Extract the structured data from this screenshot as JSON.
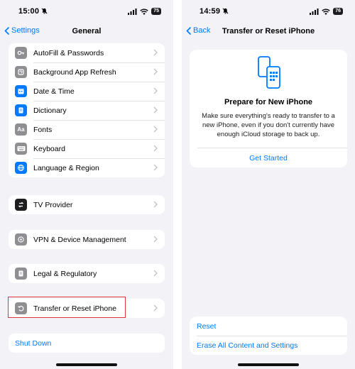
{
  "left_screen": {
    "status": {
      "time": "15:00",
      "battery": "75"
    },
    "nav": {
      "back_label": "Settings",
      "title": "General"
    },
    "group1": [
      {
        "label": "AutoFill & Passwords",
        "icon": "key-icon",
        "color": "#8e8e93"
      },
      {
        "label": "Background App Refresh",
        "icon": "refresh-icon",
        "color": "#8e8e93"
      },
      {
        "label": "Date & Time",
        "icon": "calendar-clock-icon",
        "color": "#007aff"
      },
      {
        "label": "Dictionary",
        "icon": "book-icon",
        "color": "#007aff"
      },
      {
        "label": "Fonts",
        "icon": "fonts-icon",
        "glyph": "Aa",
        "color": "#8e8e93"
      },
      {
        "label": "Keyboard",
        "icon": "keyboard-icon",
        "color": "#8e8e93"
      },
      {
        "label": "Language & Region",
        "icon": "globe-icon",
        "color": "#007aff"
      }
    ],
    "tv_provider": {
      "label": "TV Provider",
      "icon": "tv-provider-icon",
      "color": "#1c1c1e"
    },
    "vpn": {
      "label": "VPN & Device Management",
      "icon": "gear-icon",
      "color": "#8e8e93"
    },
    "legal": {
      "label": "Legal & Regulatory",
      "icon": "document-icon",
      "color": "#8e8e93"
    },
    "transfer": {
      "label": "Transfer or Reset iPhone",
      "icon": "reset-arrow-icon",
      "color": "#8e8e93",
      "highlight_color": "#e0353b"
    },
    "shutdown_label": "Shut Down"
  },
  "right_screen": {
    "status": {
      "time": "14:59",
      "battery": "76"
    },
    "nav": {
      "back_label": "Back",
      "title": "Transfer or Reset iPhone"
    },
    "card": {
      "title": "Prepare for New iPhone",
      "description": "Make sure everything's ready to transfer to a new iPhone, even if you don't currently have enough iCloud storage to back up.",
      "action_label": "Get Started"
    },
    "reset_options": [
      "Reset",
      "Erase All Content and Settings"
    ]
  },
  "colors": {
    "accent": "#007aff",
    "background": "#f2f2f7"
  }
}
